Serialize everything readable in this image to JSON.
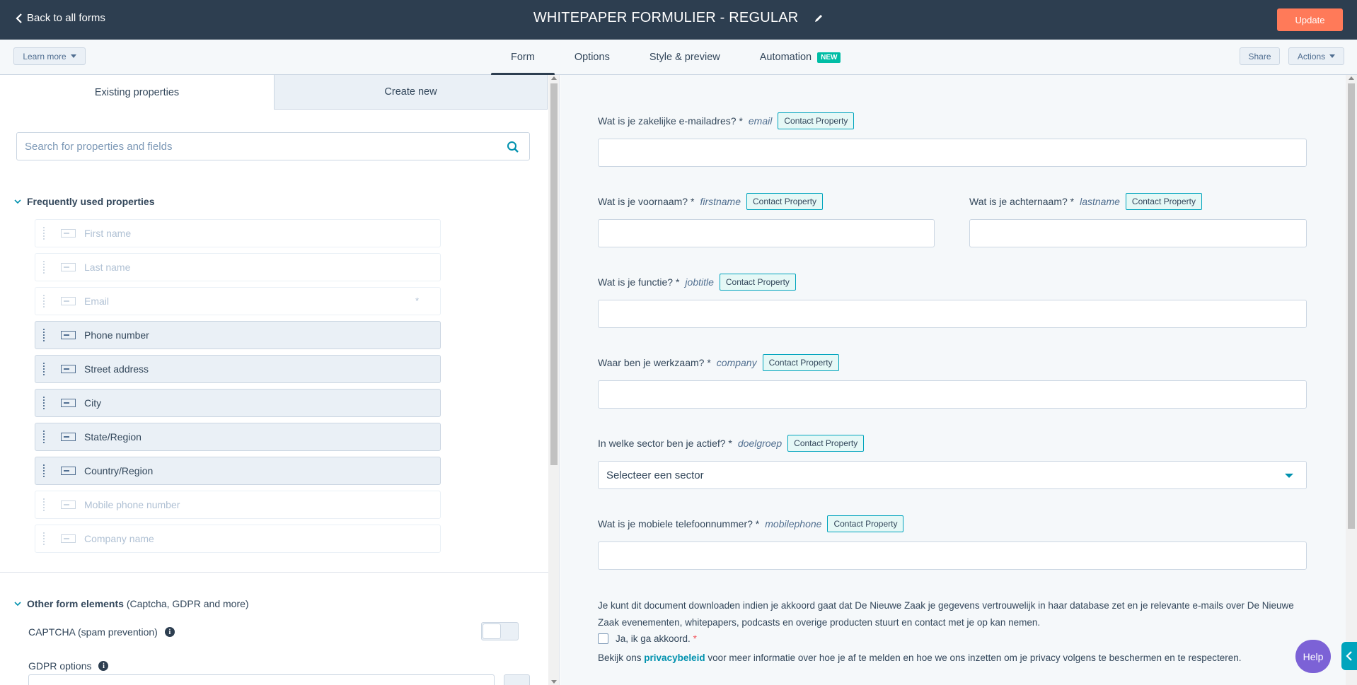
{
  "topbar": {
    "back_label": "Back to all forms",
    "form_title": "WHITEPAPER FORMULIER - REGULAR",
    "update_label": "Update"
  },
  "subbar": {
    "learn_more": "Learn more",
    "tabs": [
      {
        "label": "Form",
        "active": true
      },
      {
        "label": "Options",
        "active": false
      },
      {
        "label": "Style & preview",
        "active": false
      },
      {
        "label": "Automation",
        "active": false,
        "badge": "NEW"
      }
    ],
    "share": "Share",
    "actions": "Actions"
  },
  "left_panel": {
    "tabs": [
      "Existing properties",
      "Create new"
    ],
    "search_placeholder": "Search for properties and fields",
    "frequent_heading": "Frequently used properties",
    "properties": [
      {
        "label": "First name",
        "enabled": false,
        "required": false
      },
      {
        "label": "Last name",
        "enabled": false,
        "required": false
      },
      {
        "label": "Email",
        "enabled": false,
        "required": true
      },
      {
        "label": "Phone number",
        "enabled": true,
        "required": false
      },
      {
        "label": "Street address",
        "enabled": true,
        "required": false
      },
      {
        "label": "City",
        "enabled": true,
        "required": false
      },
      {
        "label": "State/Region",
        "enabled": true,
        "required": false
      },
      {
        "label": "Country/Region",
        "enabled": true,
        "required": false
      },
      {
        "label": "Mobile phone number",
        "enabled": false,
        "required": false
      },
      {
        "label": "Company name",
        "enabled": false,
        "required": false
      }
    ],
    "required_marker": "*",
    "other_heading": "Other form elements",
    "other_sub": "(Captcha, GDPR and more)",
    "captcha_label": "CAPTCHA (spam prevention)",
    "captcha_enabled": false,
    "gdpr_label": "GDPR options",
    "info_glyph": "i"
  },
  "preview": {
    "property_badge": "Contact Property",
    "fields": {
      "email": {
        "label": "Wat is je zakelijke e-mailadres? *",
        "name": "email"
      },
      "firstname": {
        "label": "Wat is je voornaam? *",
        "name": "firstname"
      },
      "lastname": {
        "label": "Wat is je achternaam? *",
        "name": "lastname"
      },
      "jobtitle": {
        "label": "Wat is je functie? *",
        "name": "jobtitle"
      },
      "company": {
        "label": "Waar ben je werkzaam? *",
        "name": "company"
      },
      "doelgroep": {
        "label": "In welke sector ben je actief? *",
        "name": "doelgroep",
        "selected": "Selecteer een sector"
      },
      "mobilephone": {
        "label": "Wat is je mobiele telefoonnummer? *",
        "name": "mobilephone"
      }
    },
    "consent_text": "Je kunt dit document downloaden indien je akkoord gaat dat De Nieuwe Zaak je gegevens vertrouwelijk in haar database zet en je relevante e-mails over De Nieuwe Zaak evenementen, whitepapers, podcasts en overige producten stuurt en contact met je op kan nemen.",
    "checkbox_label": "Ja, ik ga akkoord.",
    "checkbox_required": "*",
    "privacy_prefix": "Bekijk ons",
    "privacy_link": "privacybeleid",
    "privacy_suffix": "voor meer informatie over hoe je af te melden en hoe we ons inzetten om je privacy volgens te beschermen en te respecteren."
  },
  "help_label": "Help",
  "colors": {
    "header_bg": "#2d3e50",
    "accent_orange": "#ff7a59",
    "teal": "#00a4bd",
    "new_badge": "#00bda5",
    "help_purple": "#7c62d6"
  },
  "icons": [
    "chevron-left-icon",
    "pencil-icon",
    "caret-down-icon",
    "search-icon",
    "drag-handle-icon",
    "text-field-icon",
    "chevron-down-icon",
    "info-icon",
    "chevron-left-icon"
  ]
}
